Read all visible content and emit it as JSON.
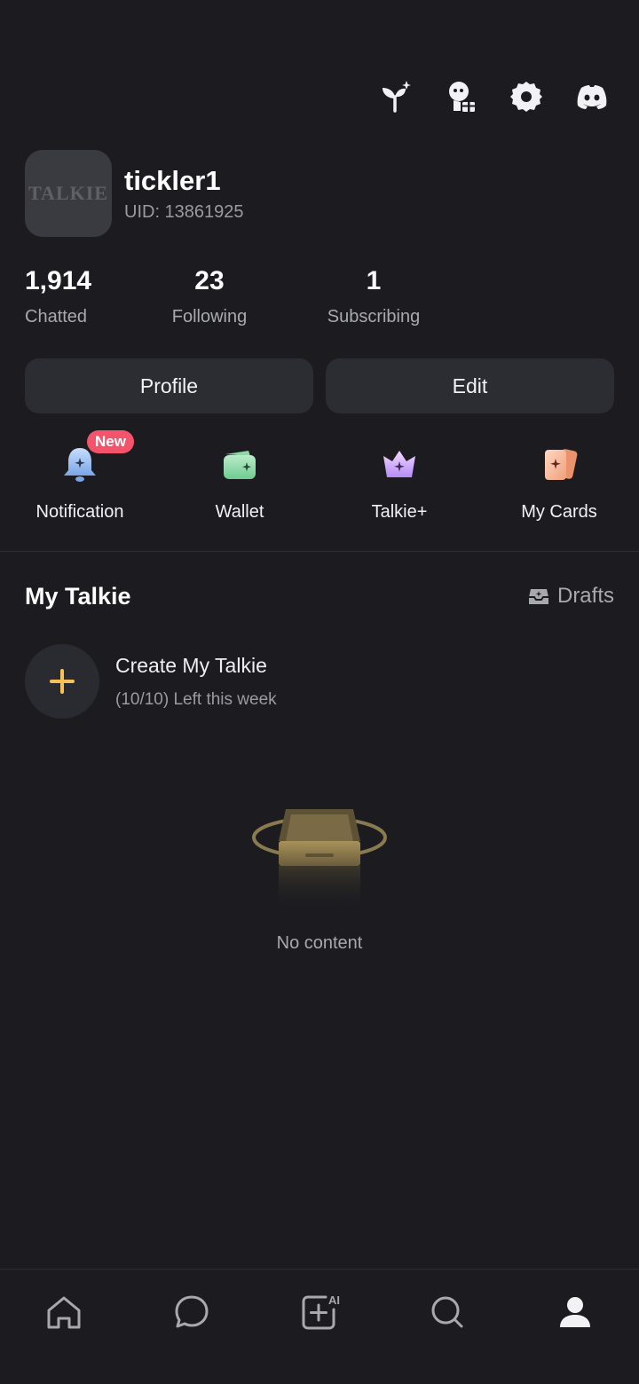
{
  "header": {
    "icons": [
      "sprout-sparkle-icon",
      "character-gift-icon",
      "gear-icon",
      "discord-icon"
    ]
  },
  "profile": {
    "avatar_text": "TALKIE",
    "username": "tickler1",
    "uid": "UID: 13861925"
  },
  "stats": [
    {
      "value": "1,914",
      "label": "Chatted"
    },
    {
      "value": "23",
      "label": "Following"
    },
    {
      "value": "1",
      "label": "Subscribing"
    }
  ],
  "buttons": {
    "profile": "Profile",
    "edit": "Edit"
  },
  "quick_actions": [
    {
      "label": "Notification",
      "icon": "bell-icon",
      "badge": "New"
    },
    {
      "label": "Wallet",
      "icon": "wallet-icon"
    },
    {
      "label": "Talkie+",
      "icon": "crown-icon"
    },
    {
      "label": "My Cards",
      "icon": "cards-icon"
    }
  ],
  "my_talkie": {
    "title": "My Talkie",
    "drafts_label": "Drafts",
    "create_title": "Create My Talkie",
    "create_subtitle": "(10/10) Left this week",
    "empty_text": "No content"
  },
  "bottom_nav": [
    "home-icon",
    "chat-icon",
    "create-ai-icon",
    "search-icon",
    "profile-icon"
  ],
  "colors": {
    "background": "#1c1c20",
    "surface": "#2c2d32",
    "badge": "#f4546b",
    "accent_plus": "#f6c257"
  }
}
